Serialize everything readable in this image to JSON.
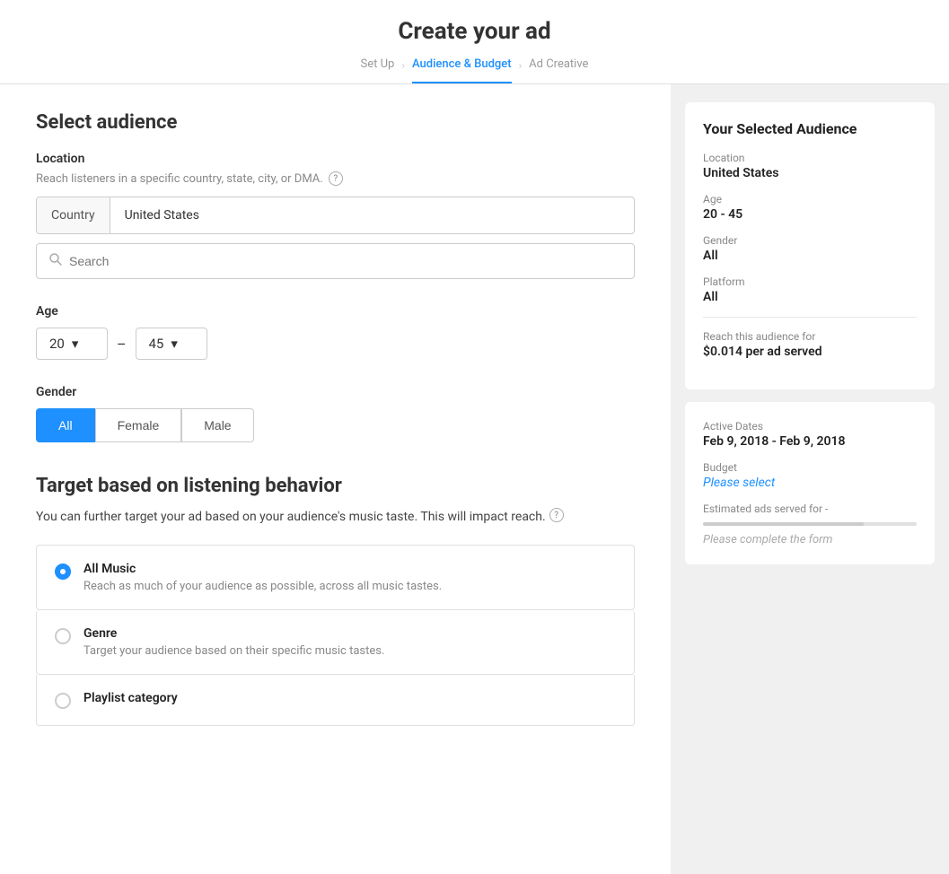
{
  "header": {
    "title": "Create your ad",
    "breadcrumbs": [
      {
        "id": "setup",
        "label": "Set Up",
        "active": false
      },
      {
        "id": "audience",
        "label": "Audience & Budget",
        "active": true
      },
      {
        "id": "creative",
        "label": "Ad Creative",
        "active": false
      }
    ]
  },
  "left": {
    "select_audience_title": "Select audience",
    "location_label": "Location",
    "location_hint": "Reach listeners in a specific country, state, city, or DMA.",
    "country_label": "Country",
    "country_value": "United States",
    "search_placeholder": "Search",
    "age_label": "Age",
    "age_from": "20",
    "age_to": "45",
    "age_dash": "–",
    "gender_label": "Gender",
    "gender_options": [
      "All",
      "Female",
      "Male"
    ],
    "gender_selected": "All",
    "target_title": "Target based on listening behavior",
    "target_desc": "You can further target your ad based on your audience's music taste. This will impact reach.",
    "music_options": [
      {
        "id": "all_music",
        "label": "All Music",
        "desc": "Reach as much of your audience as possible, across all music tastes.",
        "checked": true
      },
      {
        "id": "genre",
        "label": "Genre",
        "desc": "Target your audience based on their specific music tastes.",
        "checked": false
      },
      {
        "id": "playlist_category",
        "label": "Playlist category",
        "desc": "",
        "checked": false
      }
    ]
  },
  "right": {
    "audience_card": {
      "title": "Your Selected Audience",
      "location_label": "Location",
      "location_value": "United States",
      "age_label": "Age",
      "age_value": "20 - 45",
      "gender_label": "Gender",
      "gender_value": "All",
      "platform_label": "Platform",
      "platform_value": "All",
      "reach_label": "Reach this audience for",
      "reach_value": "$0.014 per ad served"
    },
    "dates_card": {
      "active_dates_label": "Active Dates",
      "active_dates_value": "Feb 9, 2018 - Feb 9, 2018",
      "budget_label": "Budget",
      "budget_value": "Please select",
      "estimated_label": "Estimated ads served for -",
      "please_complete": "Please complete the form"
    }
  }
}
